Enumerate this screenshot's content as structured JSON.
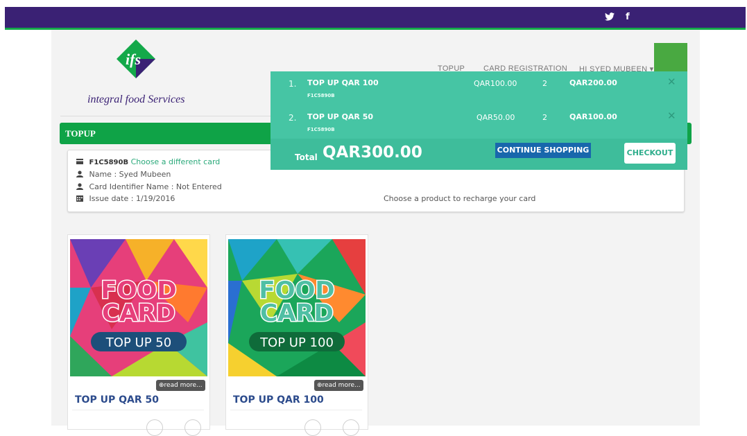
{
  "social": {
    "twitter_icon": "twitter-icon",
    "twitter_glyph": "𝕥",
    "facebook_glyph": "f"
  },
  "brand": {
    "logo_text": "ifs",
    "name": "integral food Services"
  },
  "nav": {
    "items": [
      {
        "label": "TOPUP"
      },
      {
        "label": "CARD REGISTRATION"
      },
      {
        "label": "HI SYED MUBEEN ▾"
      }
    ]
  },
  "section": {
    "title": "TOPUP"
  },
  "card_info": {
    "card_number": "F1C5890B",
    "change_link": "Choose a different card",
    "name_line": "Name : Syed Mubeen",
    "identifier_line": "Card Identifier Name : Not Entered",
    "issue_line": "Issue date : 1/19/2016",
    "instruction": "Choose a product to recharge your card"
  },
  "products": [
    {
      "name": "TOP UP QAR 50",
      "read_more": "read more...",
      "banner_top": "FOOD",
      "banner_mid": "CARD",
      "banner_bottom": "TOP UP 50"
    },
    {
      "name": "TOP UP QAR 100",
      "read_more": "read more...",
      "banner_top": "FOOD",
      "banner_mid": "CARD",
      "banner_bottom": "TOP UP 100"
    }
  ],
  "cart": {
    "items": [
      {
        "num": "1.",
        "name": "TOP UP QAR 100",
        "code": "F1C5890B",
        "unit_price": "QAR100.00",
        "qty": "2",
        "line_total": "QAR200.00",
        "remove": "✕"
      },
      {
        "num": "2.",
        "name": "TOP UP QAR 50",
        "code": "F1C5890B",
        "unit_price": "QAR50.00",
        "qty": "2",
        "line_total": "QAR100.00",
        "remove": "✕"
      }
    ],
    "total_label": "Total",
    "total_value": "QAR300.00",
    "continue_label": "CONTINUE SHOPPING",
    "checkout_label": "CHECKOUT"
  },
  "colors": {
    "topbar": "#3a2174",
    "accent_green": "#0fa347",
    "cart_bg": "#46c5a4",
    "link": "#2aa97a",
    "product_title": "#2c4b8c"
  }
}
